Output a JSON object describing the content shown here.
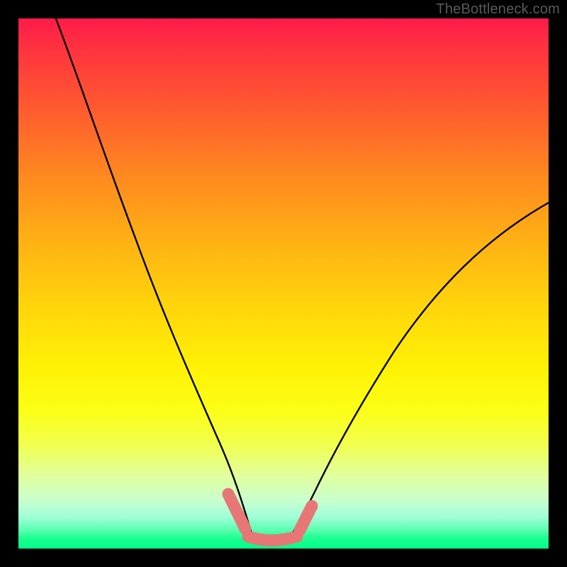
{
  "watermark": "TheBottleneck.com",
  "colors": {
    "curve": "#000000",
    "accent": "#e77777",
    "gradient_top": "#ff1a4a",
    "gradient_bottom": "#00ff88"
  },
  "chart_data": {
    "type": "line",
    "title": "",
    "xlabel": "",
    "ylabel": "",
    "xlim": [
      0,
      100
    ],
    "ylim": [
      0,
      100
    ],
    "legend": false,
    "note": "Axes unlabeled in source image; values are visual estimates of the plotted curve heights (0 = bottom/green, 100 = top/red).",
    "series": [
      {
        "name": "left-curve",
        "x": [
          7,
          10,
          14,
          18,
          22,
          26,
          30,
          33,
          36,
          38,
          40,
          42,
          44
        ],
        "y": [
          100,
          88,
          74,
          61,
          48,
          37,
          27,
          19,
          12,
          8,
          4,
          2,
          1
        ]
      },
      {
        "name": "right-curve",
        "x": [
          50,
          52,
          54,
          57,
          61,
          66,
          72,
          79,
          86,
          93,
          100
        ],
        "y": [
          1,
          3,
          6,
          10,
          17,
          25,
          34,
          43,
          51,
          58,
          65
        ]
      },
      {
        "name": "bottom-accent",
        "x": [
          40,
          42,
          44,
          46,
          48,
          50,
          52,
          54
        ],
        "y": [
          9,
          5,
          2,
          1,
          1,
          1,
          2,
          5
        ],
        "stroke": "#e77777",
        "stroke_width": 16
      }
    ]
  }
}
